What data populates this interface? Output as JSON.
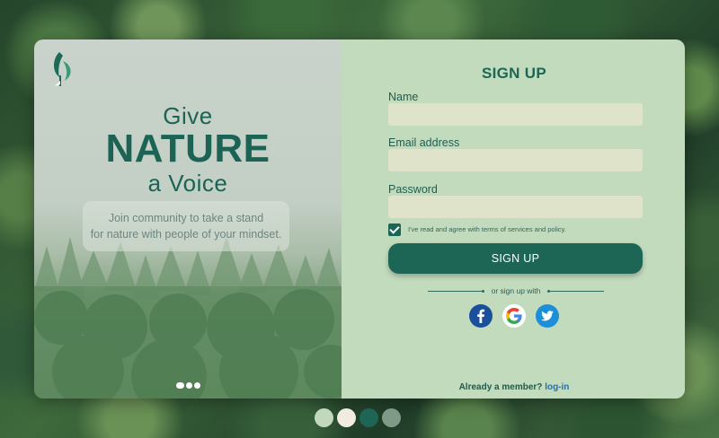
{
  "hero": {
    "line1": "Give",
    "line2": "NATURE",
    "line3": "a Voice",
    "tagline_line1": "Join community to take a stand",
    "tagline_line2": "for nature with people of your mindset."
  },
  "form": {
    "title": "SIGN UP",
    "name_label": "Name",
    "name_value": "",
    "email_label": "Email address",
    "email_value": "",
    "password_label": "Password",
    "password_value": "",
    "terms_checked": true,
    "terms_text": "I've read and agree with terms of services and policy.",
    "submit_label": "SIGN UP",
    "or_text": "or sign up with",
    "social": [
      "facebook-icon",
      "google-icon",
      "twitter-icon"
    ],
    "footer_text": "Already a member?",
    "login_link": "log-in"
  },
  "colors": {
    "primary": "#1d6555",
    "panel": "#c2dbbd",
    "field": "#dee3c9",
    "link": "#1f6fb8"
  },
  "palette": [
    "#c2d8bd",
    "#f2ebdf",
    "#1d6555",
    "#7f9a87"
  ],
  "carousel": {
    "slides": 3,
    "active": 1
  }
}
